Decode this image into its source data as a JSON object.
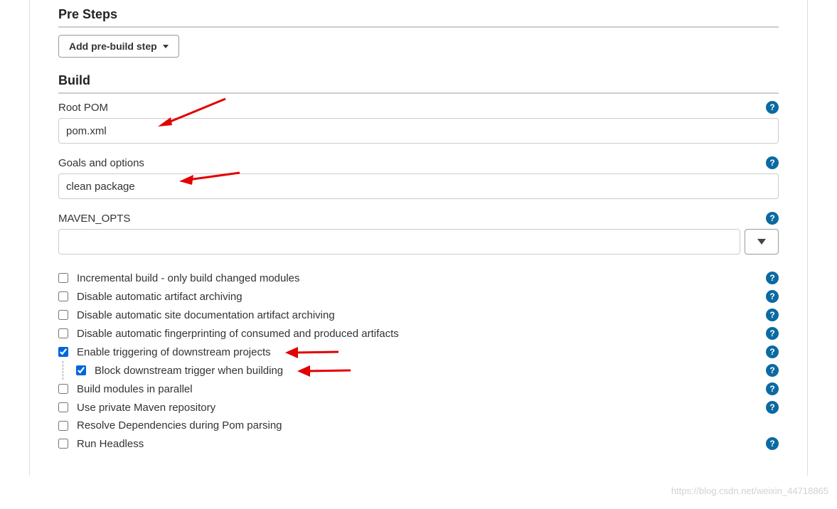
{
  "preSteps": {
    "title": "Pre Steps",
    "addButton": "Add pre-build step"
  },
  "build": {
    "title": "Build",
    "rootPom": {
      "label": "Root POM",
      "value": "pom.xml"
    },
    "goals": {
      "label": "Goals and options",
      "value": "clean package"
    },
    "mavenOpts": {
      "label": "MAVEN_OPTS",
      "value": ""
    },
    "options": [
      {
        "label": "Incremental build - only build changed modules",
        "checked": false,
        "nested": false,
        "help": true
      },
      {
        "label": "Disable automatic artifact archiving",
        "checked": false,
        "nested": false,
        "help": true
      },
      {
        "label": "Disable automatic site documentation artifact archiving",
        "checked": false,
        "nested": false,
        "help": true
      },
      {
        "label": "Disable automatic fingerprinting of consumed and produced artifacts",
        "checked": false,
        "nested": false,
        "help": true
      },
      {
        "label": "Enable triggering of downstream projects",
        "checked": true,
        "nested": false,
        "help": true
      },
      {
        "label": "Block downstream trigger when building",
        "checked": true,
        "nested": true,
        "help": true
      },
      {
        "label": "Build modules in parallel",
        "checked": false,
        "nested": false,
        "help": true
      },
      {
        "label": "Use private Maven repository",
        "checked": false,
        "nested": false,
        "help": true
      },
      {
        "label": "Resolve Dependencies during Pom parsing",
        "checked": false,
        "nested": false,
        "help": false
      },
      {
        "label": "Run Headless",
        "checked": false,
        "nested": false,
        "help": true
      }
    ]
  },
  "watermark": "https://blog.csdn.net/weixin_44718865"
}
